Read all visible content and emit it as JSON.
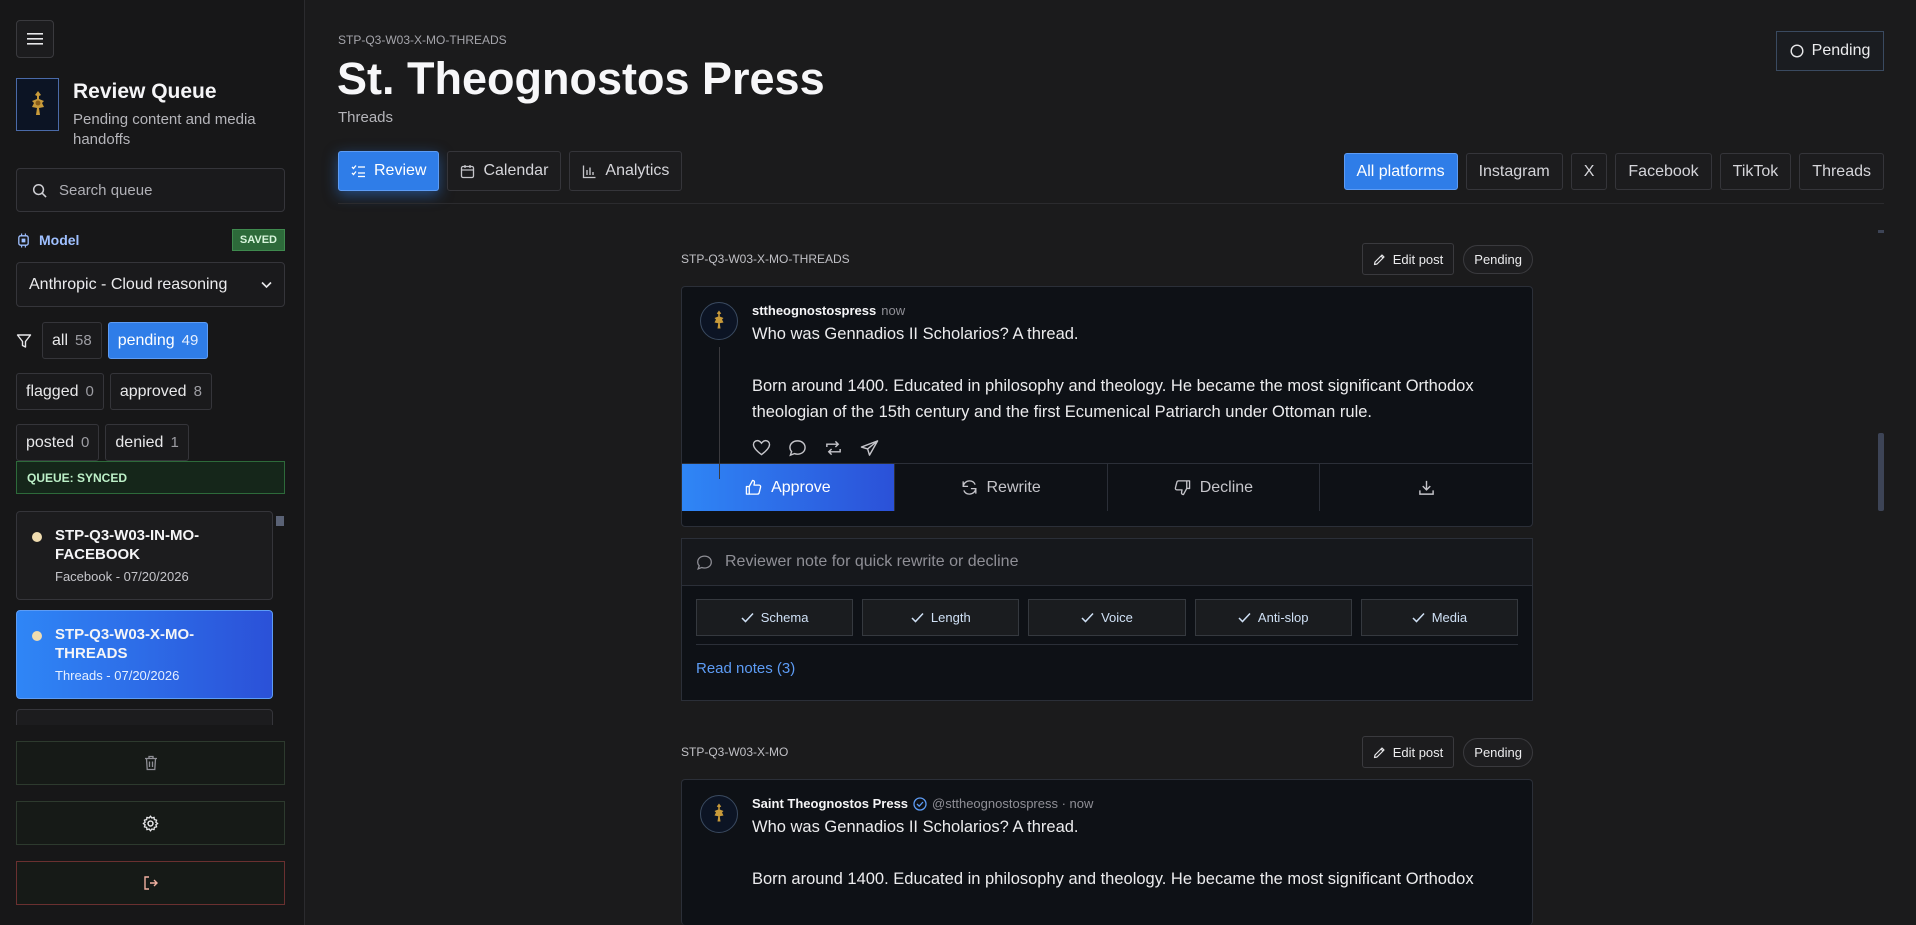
{
  "sidebar": {
    "title": "Review Queue",
    "subtitle": "Pending content and media handoffs",
    "search_placeholder": "Search queue",
    "model_label": "Model",
    "saved_badge": "SAVED",
    "model_value": "Anthropic - Cloud reasoning",
    "filters": [
      {
        "label": "all",
        "count": "58"
      },
      {
        "label": "pending",
        "count": "49"
      },
      {
        "label": "flagged",
        "count": "0"
      },
      {
        "label": "approved",
        "count": "8"
      },
      {
        "label": "posted",
        "count": "0"
      },
      {
        "label": "denied",
        "count": "1"
      }
    ],
    "sync_status": "QUEUE: SYNCED",
    "queue_items": [
      {
        "title": "STP-Q3-W03-IN-MO-FACEBOOK",
        "sub": "Facebook - 07/20/2026"
      },
      {
        "title": "STP-Q3-W03-X-MO-THREADS",
        "sub": "Threads - 07/20/2026"
      }
    ]
  },
  "header": {
    "code": "STP-Q3-W03-X-MO-THREADS",
    "title": "St. Theognostos Press",
    "subtitle": "Threads",
    "status": "Pending"
  },
  "view_tabs": [
    "Review",
    "Calendar",
    "Analytics"
  ],
  "platform_tabs": [
    "All platforms",
    "Instagram",
    "X",
    "Facebook",
    "TikTok",
    "Threads"
  ],
  "posts": [
    {
      "code": "STP-Q3-W03-X-MO-THREADS",
      "edit_label": "Edit post",
      "status": "Pending",
      "author": "sttheognostospress",
      "time": "now",
      "text": "Who was Gennadios II Scholarios? A thread.\n\nBorn around 1400. Educated in philosophy and theology. He became the most significant Orthodox theologian of the 15th century and the first Ecumenical Patriarch under Ottoman rule."
    },
    {
      "code": "STP-Q3-W03-X-MO",
      "edit_label": "Edit post",
      "status": "Pending",
      "author": "Saint Theognostos Press",
      "handle": "@sttheognostospress · now",
      "text": "Who was Gennadios II Scholarios? A thread.\n\nBorn around 1400. Educated in philosophy and theology. He became the most significant Orthodox"
    }
  ],
  "actions": {
    "approve": "Approve",
    "rewrite": "Rewrite",
    "decline": "Decline"
  },
  "note_placeholder": "Reviewer note for quick rewrite or decline",
  "checks": [
    "Schema",
    "Length",
    "Voice",
    "Anti-slop",
    "Media"
  ],
  "read_notes": "Read notes (3)",
  "icons": {
    "menu": "hamburger-icon",
    "search": "search-icon",
    "model": "cpu-icon",
    "filter": "filter-icon",
    "delete": "trash-icon",
    "settings": "gear-icon",
    "logout": "logout-icon"
  },
  "colors": {
    "accent": "#2f7de8",
    "success": "#2d6a3a",
    "background": "#1b1b1c"
  }
}
